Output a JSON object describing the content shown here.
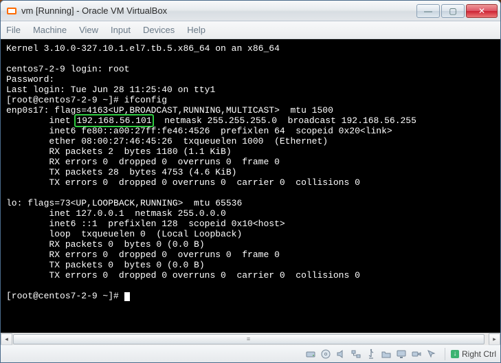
{
  "window": {
    "title": "vm [Running] - Oracle VM VirtualBox",
    "minimize": "—",
    "maximize": "▢",
    "close": "✕"
  },
  "menu": {
    "file": "File",
    "machine": "Machine",
    "view": "View",
    "input": "Input",
    "devices": "Devices",
    "help": "Help"
  },
  "terminal": {
    "l1": "Kernel 3.10.0-327.10.1.el7.tb.5.x86_64 on an x86_64",
    "l2": "",
    "l3": "centos7-2-9 login: root",
    "l4": "Password:",
    "l5": "Last login: Tue Jun 28 11:25:40 on tty1",
    "l6": "[root@centos7-2-9 ~]# ifconfig",
    "l7": "enp0s17: flags=4163<UP,BROADCAST,RUNNING,MULTICAST>  mtu 1500",
    "l8a": "        inet ",
    "l8b": "192.168.56.101",
    "l8c": "  netmask 255.255.255.0  broadcast 192.168.56.255",
    "l9": "        inet6 fe80::a00:27ff:fe46:4526  prefixlen 64  scopeid 0x20<link>",
    "l10": "        ether 08:00:27:46:45:26  txqueuelen 1000  (Ethernet)",
    "l11": "        RX packets 2  bytes 1180 (1.1 KiB)",
    "l12": "        RX errors 0  dropped 0  overruns 0  frame 0",
    "l13": "        TX packets 28  bytes 4753 (4.6 KiB)",
    "l14": "        TX errors 0  dropped 0 overruns 0  carrier 0  collisions 0",
    "l15": "",
    "l16": "lo: flags=73<UP,LOOPBACK,RUNNING>  mtu 65536",
    "l17": "        inet 127.0.0.1  netmask 255.0.0.0",
    "l18": "        inet6 ::1  prefixlen 128  scopeid 0x10<host>",
    "l19": "        loop  txqueuelen 0  (Local Loopback)",
    "l20": "        RX packets 0  bytes 0 (0.0 B)",
    "l21": "        RX errors 0  dropped 0  overruns 0  frame 0",
    "l22": "        TX packets 0  bytes 0 (0.0 B)",
    "l23": "        TX errors 0  dropped 0 overruns 0  carrier 0  collisions 0",
    "l24": "",
    "l25": "[root@centos7-2-9 ~]# "
  },
  "status": {
    "hostkey": "Right Ctrl"
  }
}
